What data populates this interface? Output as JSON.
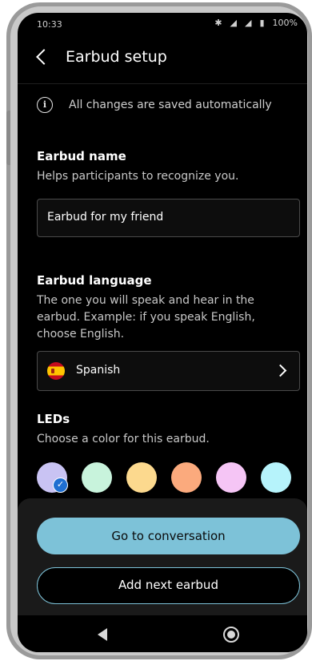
{
  "status_bar": {
    "time": "10:33",
    "bluetooth_icon": "bluetooth-icon",
    "wifi_icon": "wifi-icon",
    "signal_icon": "signal-icon",
    "battery_icon": "battery-icon",
    "battery": "100%"
  },
  "app_bar": {
    "back_icon": "chevron-left-icon",
    "title": "Earbud setup"
  },
  "notice": {
    "icon": "info-icon",
    "text": "All changes are saved automatically"
  },
  "name_section": {
    "title": "Earbud name",
    "description": "Helps participants to recognize you.",
    "value": "Earbud for my friend"
  },
  "language_section": {
    "title": "Earbud language",
    "description": "The one you will speak and hear in the earbud. Example: if you speak English, choose English.",
    "selected": "Spanish",
    "flag_icon": "spain-flag-icon",
    "chevron_icon": "chevron-right-icon"
  },
  "leds_section": {
    "title": "LEDs",
    "description": "Choose a color for this earbud.",
    "colors": [
      "#c9c3f3",
      "#c8f3dc",
      "#fcd98e",
      "#fbaa7d",
      "#f5c5f5",
      "#b6f3fb"
    ],
    "selected_index": 0,
    "selected_icon": "check-icon"
  },
  "actions": {
    "primary": "Go to conversation",
    "secondary": "Add next earbud",
    "accent": "#7dc2d8"
  },
  "nav_bar": {
    "back_icon": "nav-back-icon",
    "home_icon": "nav-home-icon"
  }
}
